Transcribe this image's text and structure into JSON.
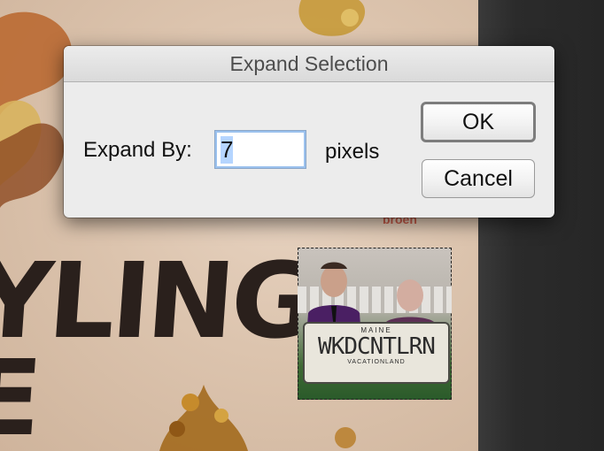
{
  "dialog": {
    "title": "Expand Selection",
    "expand_label": "Expand By:",
    "expand_value": "7",
    "units": "pixels",
    "ok_label": "OK",
    "cancel_label": "Cancel"
  },
  "background": {
    "poster_text": "YLING\nE",
    "red_text": "broen",
    "plate": {
      "state": "MAINE",
      "number": "WKDCNTLRN",
      "motto": "VACATIONLAND"
    }
  },
  "colors": {
    "dialog_bg": "#ececec",
    "focus_ring": "#9cc2ee",
    "text": "#111111"
  }
}
